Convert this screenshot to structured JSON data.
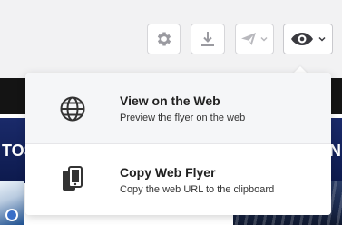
{
  "background": {
    "banner_left_text": "TOS",
    "banner_right_text": "N"
  },
  "toolbar": {
    "buttons": [
      {
        "name": "settings",
        "icon": "gear-icon"
      },
      {
        "name": "download",
        "icon": "download-icon"
      },
      {
        "name": "send",
        "icon": "paper-plane-icon",
        "has_dropdown": true
      },
      {
        "name": "view",
        "icon": "eye-icon",
        "has_dropdown": true,
        "active": true
      }
    ]
  },
  "dropdown": {
    "items": [
      {
        "icon": "globe-icon",
        "title": "View on the Web",
        "subtitle": "Preview the flyer on the web"
      },
      {
        "icon": "copy-phone-icon",
        "title": "Copy Web Flyer",
        "subtitle": "Copy the web URL to the clipboard"
      }
    ]
  },
  "colors": {
    "icon_gray": "#9a9aa0",
    "icon_dark": "#3a3a3f",
    "send_icon": "#b8b8bd"
  }
}
